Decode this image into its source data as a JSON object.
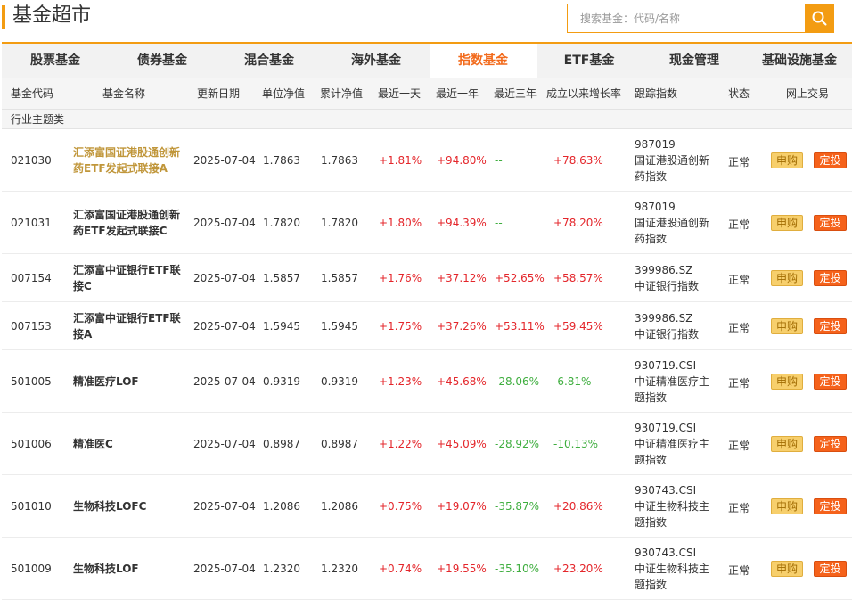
{
  "header": {
    "title": "基金超市",
    "search_placeholder": "搜索基金：代码/名称"
  },
  "tabs": [
    {
      "label": "股票基金",
      "active": false
    },
    {
      "label": "债券基金",
      "active": false
    },
    {
      "label": "混合基金",
      "active": false
    },
    {
      "label": "海外基金",
      "active": false
    },
    {
      "label": "指数基金",
      "active": true
    },
    {
      "label": "ETF基金",
      "active": false
    },
    {
      "label": "现金管理",
      "active": false
    },
    {
      "label": "基础设施基金",
      "active": false
    }
  ],
  "table": {
    "columns": [
      "基金代码",
      "基金名称",
      "更新日期",
      "单位净值",
      "累计净值",
      "最近一天",
      "最近一年",
      "最近三年",
      "成立以来增长率",
      "跟踪指数",
      "状态",
      "网上交易"
    ],
    "group_label": "行业主题类",
    "buy_label": "申购",
    "fixed_label": "定投",
    "rows": [
      {
        "code": "021030",
        "name": "汇添富国证港股通创新药ETF发起式联接A",
        "date": "2025-07-04",
        "nav": "1.7863",
        "acc_nav": "1.7863",
        "day": "+1.81%",
        "year": "+94.80%",
        "three_year": "--",
        "since": "+78.63%",
        "index_code": "987019",
        "index_name": "国证港股通创新药指数",
        "status": "正常",
        "highlight": true
      },
      {
        "code": "021031",
        "name": "汇添富国证港股通创新药ETF发起式联接C",
        "date": "2025-07-04",
        "nav": "1.7820",
        "acc_nav": "1.7820",
        "day": "+1.80%",
        "year": "+94.39%",
        "three_year": "--",
        "since": "+78.20%",
        "index_code": "987019",
        "index_name": "国证港股通创新药指数",
        "status": "正常",
        "highlight": false
      },
      {
        "code": "007154",
        "name": "汇添富中证银行ETF联接C",
        "date": "2025-07-04",
        "nav": "1.5857",
        "acc_nav": "1.5857",
        "day": "+1.76%",
        "year": "+37.12%",
        "three_year": "+52.65%",
        "since": "+58.57%",
        "index_code": "399986.SZ",
        "index_name": "中证银行指数",
        "status": "正常",
        "highlight": false
      },
      {
        "code": "007153",
        "name": "汇添富中证银行ETF联接A",
        "date": "2025-07-04",
        "nav": "1.5945",
        "acc_nav": "1.5945",
        "day": "+1.75%",
        "year": "+37.26%",
        "three_year": "+53.11%",
        "since": "+59.45%",
        "index_code": "399986.SZ",
        "index_name": "中证银行指数",
        "status": "正常",
        "highlight": false
      },
      {
        "code": "501005",
        "name": "精准医疗LOF",
        "date": "2025-07-04",
        "nav": "0.9319",
        "acc_nav": "0.9319",
        "day": "+1.23%",
        "year": "+45.68%",
        "three_year": "-28.06%",
        "since": "-6.81%",
        "index_code": "930719.CSI",
        "index_name": "中证精准医疗主题指数",
        "status": "正常",
        "highlight": false
      },
      {
        "code": "501006",
        "name": "精准医C",
        "date": "2025-07-04",
        "nav": "0.8987",
        "acc_nav": "0.8987",
        "day": "+1.22%",
        "year": "+45.09%",
        "three_year": "-28.92%",
        "since": "-10.13%",
        "index_code": "930719.CSI",
        "index_name": "中证精准医疗主题指数",
        "status": "正常",
        "highlight": false
      },
      {
        "code": "501010",
        "name": "生物科技LOFC",
        "date": "2025-07-04",
        "nav": "1.2086",
        "acc_nav": "1.2086",
        "day": "+0.75%",
        "year": "+19.07%",
        "three_year": "-35.87%",
        "since": "+20.86%",
        "index_code": "930743.CSI",
        "index_name": "中证生物科技主题指数",
        "status": "正常",
        "highlight": false
      },
      {
        "code": "501009",
        "name": "生物科技LOF",
        "date": "2025-07-04",
        "nav": "1.2320",
        "acc_nav": "1.2320",
        "day": "+0.74%",
        "year": "+19.55%",
        "three_year": "-35.10%",
        "since": "+23.20%",
        "index_code": "930743.CSI",
        "index_name": "中证生物科技主题指数",
        "status": "正常",
        "highlight": false
      }
    ]
  },
  "colors": {
    "accent": "#f39c12",
    "active_tab": "#f26a1b",
    "rise": "#e4262b",
    "fall": "#3fae3f",
    "highlight_name": "#c0963a"
  },
  "icons": {
    "search": "search-icon"
  }
}
